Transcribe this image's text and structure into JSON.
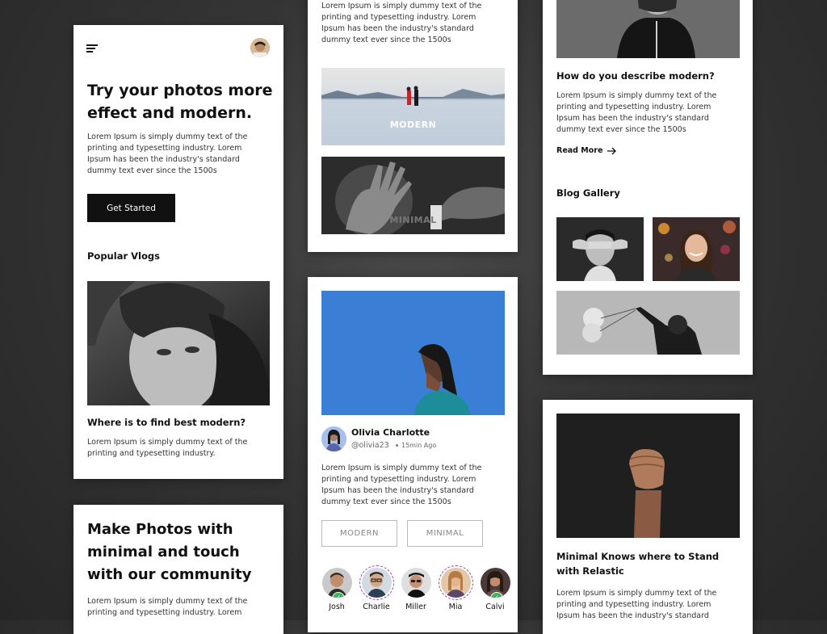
{
  "colors": {
    "background": "#2e2e2e",
    "card": "#ffffff",
    "accent": "#111111",
    "sky_blue": "#3a7ed6",
    "verified_green": "#3cb55a"
  },
  "home_card": {
    "headline": "Try your photos more effect and modern.",
    "body": "Lorem Ipsum is simply dummy text of the printing and typesetting industry. Lorem Ipsum has been the industry's standard dummy text ever since the 1500s",
    "cta_label": "Get Started",
    "section_title": "Popular Vlogs",
    "vlog_title": "Where is to find best modern?",
    "vlog_text": "Lorem Ipsum is simply dummy text of the printing and typesetting industry."
  },
  "community_card": {
    "headline": "Make Photos with minimal and touch with our community",
    "body": "Lorem Ipsum is simply dummy text of the printing and typesetting industry. Lorem"
  },
  "categories_card": {
    "intro": "Lorem Ipsum is simply dummy text of the printing and typesetting industry. Lorem Ipsum has been the industry's standard dummy text ever since the 1500s",
    "tiles": [
      "MODERN",
      "MINIMAL"
    ]
  },
  "post_card": {
    "author_name": "Olivia Charlotte",
    "author_handle": "@olivia23",
    "time_ago": "15min Ago",
    "text": "Lorem Ipsum is simply dummy text of the printing and typesetting industry. Lorem Ipsum has been the industry's standard dummy text ever since the 1500s",
    "tags": [
      "MODERN",
      "MINIMAL"
    ],
    "users": [
      {
        "name": "Josh",
        "verified": true
      },
      {
        "name": "Charlie",
        "verified": false
      },
      {
        "name": "Miller",
        "verified": false
      },
      {
        "name": "Mia",
        "verified": false
      },
      {
        "name": "Calvi",
        "verified": true
      }
    ]
  },
  "article_card": {
    "title": "How do you describe modern?",
    "text": "Lorem Ipsum is simply dummy text of the printing and typesetting industry. Lorem Ipsum has been the industry's standard dummy text ever since the 1500s",
    "read_more": "Read More",
    "gallery_title": "Blog Gallery"
  },
  "fist_card": {
    "title": "Minimal Knows where to Stand with Relastic",
    "text": "Lorem Ipsum is simply dummy text of the printing and typesetting industry. Lorem Ipsum has been the industry's standard"
  }
}
